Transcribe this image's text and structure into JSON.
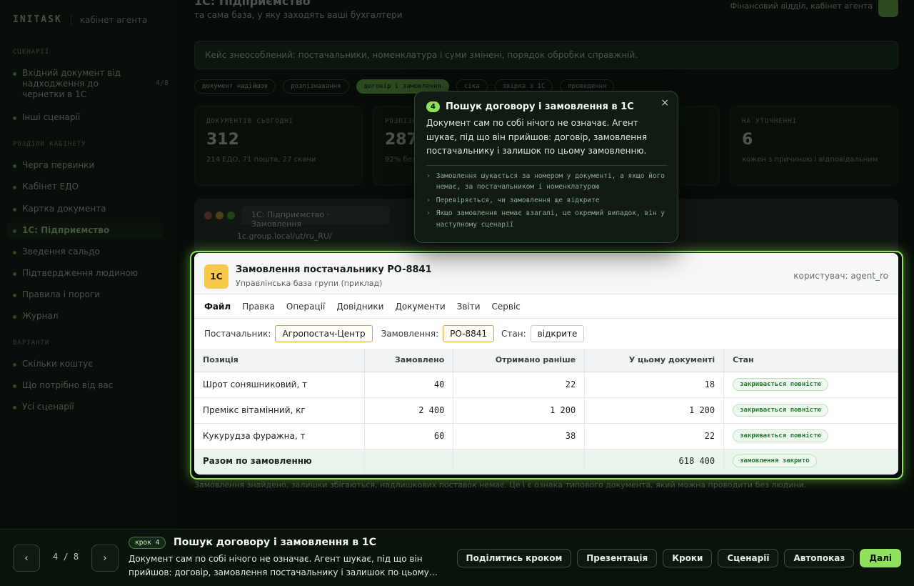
{
  "sidebar": {
    "logo": "INITASK",
    "logo_sub": "кабінет агента",
    "section_scenario": "СЦЕНАРІЇ",
    "scenario_items": [
      {
        "label": "Вхідний документ від надходження до чернетки в 1С",
        "count": "4/8"
      },
      {
        "label": "Інші сценарії"
      }
    ],
    "section_sections": "РОЗДІЛИ КАБІНЕТУ",
    "section_items": [
      {
        "label": "Черга первинки"
      },
      {
        "label": "Кабінет ЕДО"
      },
      {
        "label": "Картка документа"
      },
      {
        "label": "1С: Підприємство"
      },
      {
        "label": "Зведення сальдо"
      },
      {
        "label": "Підтвердження людиною"
      },
      {
        "label": "Правила і пороги"
      },
      {
        "label": "Журнал"
      }
    ],
    "section_extra": "ВАРІАНТИ",
    "extra_items": [
      {
        "label": "Скільки коштує"
      },
      {
        "label": "Що потрібно від вас"
      },
      {
        "label": "Усі сценарії"
      }
    ]
  },
  "bg": {
    "title": "1С: Підприємство",
    "subtitle": "та сама база, у яку заходять ваші бухгалтери",
    "top_right": "Фінансовий відділ, кабінет агента",
    "banner": "Кейс знеособлений: постачальники, номенклатура і суми змінені, порядок обробки справжній.",
    "chips": [
      {
        "label": "документ надійшов"
      },
      {
        "label": "розпізнавання"
      },
      {
        "label": "договір і замовлення"
      },
      {
        "label": "сіка"
      },
      {
        "label": "звірка з 1С"
      },
      {
        "label": "проведення"
      }
    ],
    "cards": [
      {
        "key": "ДОКУМЕНТІВ СЬОГОДНІ",
        "value": "312",
        "sub": "214 ЕДО, 71 пошта, 27 скани"
      },
      {
        "key": "РОЗПІЗНАНО",
        "value": "287",
        "sub": "92% без правок"
      },
      {
        "key": "",
        "value": "",
        "sub": ""
      },
      {
        "key": "НА УТОЧНЕННІ",
        "value": "6",
        "sub": "кожен з причиною і відповідальним"
      }
    ],
    "browser_tab": "1С: Підприємство · Замовлення",
    "browser_url": "1c.group.local/ut/ru_RU/",
    "footer": "Замовлення знайдено, залишки збігаються, надлишкових поставок немає. Це і є ознака типового документа, який можна проводити без людини."
  },
  "onec": {
    "logo": "1С",
    "title": "Замовлення постачальнику PO-8841",
    "subtitle": "Управлінська база групи (приклад)",
    "user": "користувач: agent_ro",
    "menu": [
      "Файл",
      "Правка",
      "Операції",
      "Довідники",
      "Документи",
      "Звіти",
      "Сервіс"
    ],
    "filters": {
      "supplier_label": "Постачальник:",
      "supplier_value": "Агропостач-Центр",
      "order_label": "Замовлення:",
      "order_value": "PO-8841",
      "state_label": "Стан:",
      "state_value": "відкрите"
    },
    "columns": [
      "Позиція",
      "Замовлено",
      "Отримано раніше",
      "У цьому документі",
      "Стан"
    ],
    "rows": [
      {
        "item": "Шрот соняшниковий, т",
        "ordered": "40",
        "received": "22",
        "this_doc": "18",
        "state": "закривається повністю"
      },
      {
        "item": "Премікс вітамінний, кг",
        "ordered": "2 400",
        "received": "1 200",
        "this_doc": "1 200",
        "state": "закривається повністю"
      },
      {
        "item": "Кукурудза фуражна, т",
        "ordered": "60",
        "received": "38",
        "this_doc": "22",
        "state": "закривається повністю"
      }
    ],
    "total": {
      "label": "Разом по замовленню",
      "ordered": "",
      "received": "",
      "this_doc": "618 400",
      "state": "замовлення закрито"
    }
  },
  "popover": {
    "step_num": "4",
    "title": "Пошук договору і замовлення в 1С",
    "body": "Документ сам по собі нічого не означає. Агент шукає, під що він прийшов: договір, замовлення постачальнику і залишок по цьому замовленню.",
    "bullets": [
      "Замовлення шукається за номером у документі, а якщо його немає, за постачальником і номенклатурою",
      "Перевіряється, чи замовлення ще відкрите",
      "Якщо замовлення немає взагалі, це окремий випадок, він у наступному сценарії"
    ],
    "close": "×"
  },
  "bottom": {
    "prev": "‹",
    "next": "›",
    "counter": "4 / 8",
    "step_badge": "крок 4",
    "step_title": "Пошук договору і замовлення в 1С",
    "step_desc": "Документ сам по собі нічого не означає. Агент шукає, під що він прийшов: договір, замовлення постачальнику і залишок по цьому…",
    "buttons": {
      "share": "Поділитись кроком",
      "presentation": "Презентація",
      "steps": "Кроки",
      "scenarios": "Сценарії",
      "autoplay": "Автопоказ",
      "next": "Далі"
    }
  },
  "colors": {
    "accent": "#8fe05c",
    "background": "#070c08",
    "order_field_border": "#d8a640"
  }
}
